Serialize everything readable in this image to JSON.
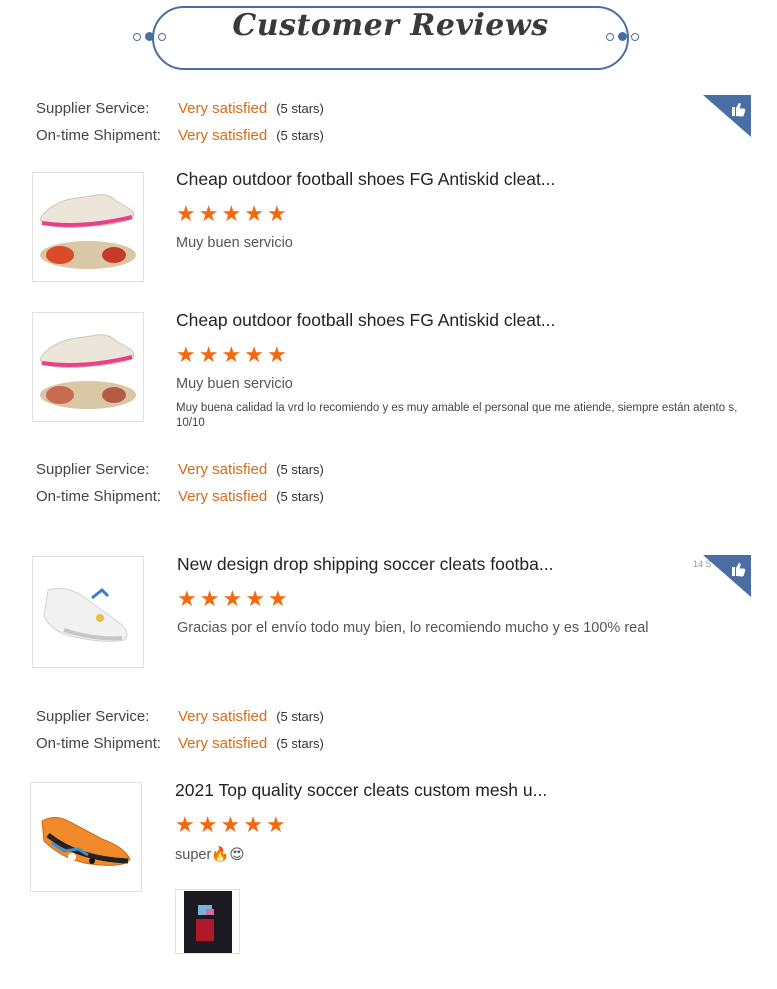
{
  "header": {
    "title": "Customer Reviews"
  },
  "rating_labels": {
    "supplier": "Supplier Service:",
    "shipment": "On-time Shipment:",
    "value": "Very satisfied",
    "stars": "(5 stars)"
  },
  "reviews": [
    {
      "title": "Cheap outdoor football shoes FG Antiskid cleat...",
      "rating": 5,
      "comment": "Muy buen servicio"
    },
    {
      "title": "Cheap outdoor football shoes FG Antiskid cleat...",
      "rating": 5,
      "comment": "Muy buen servicio",
      "detail": "Muy buena calidad la vrd lo recomiendo y es muy amable el personal que me atiende, siempre están atento s, 10/10"
    },
    {
      "title": "New design drop shipping soccer cleats footba...",
      "rating": 5,
      "comment": "Gracias por el envío todo muy bien, lo recomiendo mucho y es 100% real",
      "date": "14 S"
    },
    {
      "title": "2021 Top quality soccer cleats custom mesh u...",
      "rating": 5,
      "comment": "super🔥😍"
    }
  ],
  "colors": {
    "accent": "#4a6ea3",
    "star": "#f26a10",
    "satisfied": "#d86a1a"
  },
  "icons": {
    "badge": "thumbs-up-icon",
    "star": "star-icon"
  }
}
